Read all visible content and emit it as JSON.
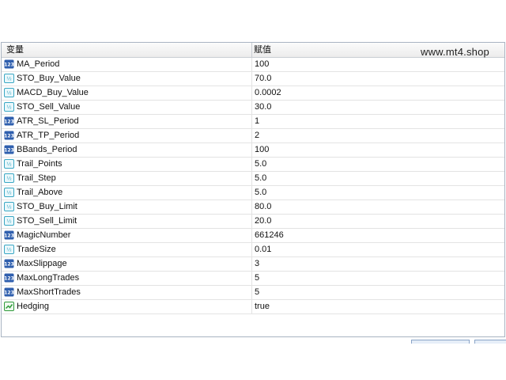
{
  "header": {
    "variable_label": "变量",
    "value_label": "赋值"
  },
  "watermark": "www.mt4.shop",
  "rows": [
    {
      "name": "MA_Period",
      "value": "100",
      "icon": "int-icon"
    },
    {
      "name": "STO_Buy_Value",
      "value": "70.0",
      "icon": "double-icon"
    },
    {
      "name": "MACD_Buy_Value",
      "value": "0.0002",
      "icon": "double-icon"
    },
    {
      "name": "STO_Sell_Value",
      "value": "30.0",
      "icon": "double-icon"
    },
    {
      "name": "ATR_SL_Period",
      "value": "1",
      "icon": "int-icon"
    },
    {
      "name": "ATR_TP_Period",
      "value": "2",
      "icon": "int-icon"
    },
    {
      "name": "BBands_Period",
      "value": "100",
      "icon": "int-icon"
    },
    {
      "name": "Trail_Points",
      "value": "5.0",
      "icon": "double-icon"
    },
    {
      "name": "Trail_Step",
      "value": "5.0",
      "icon": "double-icon"
    },
    {
      "name": "Trail_Above",
      "value": "5.0",
      "icon": "double-icon"
    },
    {
      "name": "STO_Buy_Limit",
      "value": "80.0",
      "icon": "double-icon"
    },
    {
      "name": "STO_Sell_Limit",
      "value": "20.0",
      "icon": "double-icon"
    },
    {
      "name": "MagicNumber",
      "value": "661246",
      "icon": "int-icon"
    },
    {
      "name": "TradeSize",
      "value": "0.01",
      "icon": "double-icon"
    },
    {
      "name": "MaxSlippage",
      "value": "3",
      "icon": "int-icon"
    },
    {
      "name": "MaxLongTrades",
      "value": "5",
      "icon": "int-icon"
    },
    {
      "name": "MaxShortTrades",
      "value": "5",
      "icon": "int-icon"
    },
    {
      "name": "Hedging",
      "value": "true",
      "icon": "bool-icon"
    }
  ],
  "colors": {
    "int_icon": "#2f5fae",
    "double_icon": "#3aa7c4",
    "bool_icon": "#2e9a3a"
  }
}
